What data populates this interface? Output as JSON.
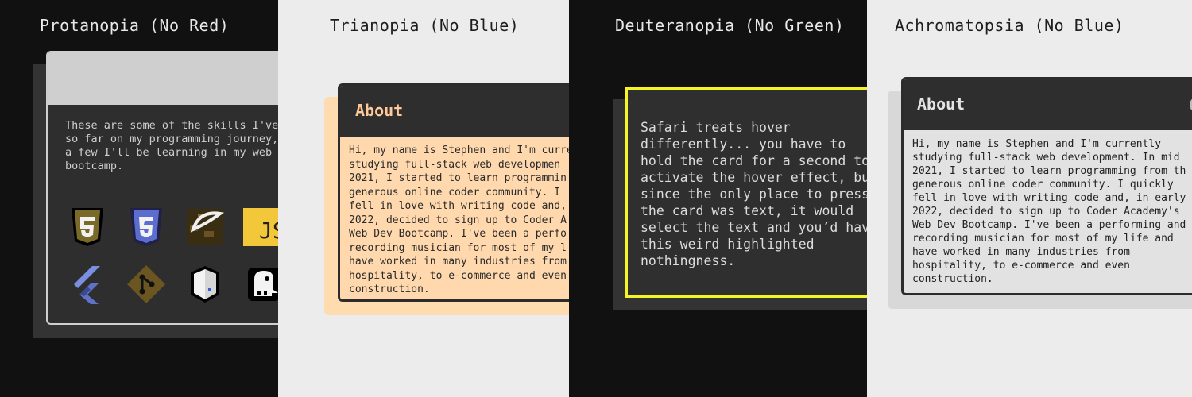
{
  "panels": [
    {
      "title": "Protanopia (No Red)",
      "card_text": "These are some of the skills I've\nso far on my programming journey,\na few I'll be learning in my web d\nbootcamp.",
      "icons": [
        "html5-icon",
        "css3-icon",
        "rails-icon",
        "javascript-icon",
        "flutter-icon",
        "git-icon",
        "npm-icon",
        "postgresql-icon"
      ],
      "icon_text": {
        "javascript": "JS"
      }
    },
    {
      "title": "Trianopia (No Blue)",
      "heading": "About",
      "card_text": "Hi, my name is Stephen and I'm curre\nstudying full-stack web developmen\n2021, I started to learn programmin\ngenerous online coder community. I\nfell in love with writing code and,\n2022, decided to sign up to Coder A\nWeb Dev Bootcamp. I've been a perfo\nrecording musician for most of my l\nhave worked in many industries from\nhospitality, to e-commerce and even\nconstruction."
    },
    {
      "title": "Deuteranopia (No Green)",
      "card_text": "Safari treats hover\ndifferently... you have to\nhold the card for a second to\nactivate the hover effect, bu\nsince the only place to press\nthe card was text, it would\nselect the text and you’d hav\nthis weird highlighted\nnothingness."
    },
    {
      "title": "Achromatopsia (No Blue)",
      "heading": "About",
      "card_text": "Hi, my name is Stephen and I'm currently\nstudying full-stack web development. In mid\n2021, I started to learn programming from th\ngenerous online coder community. I quickly\nfell in love with writing code and, in early\n2022, decided to sign up to Coder Academy's\nWeb Dev Bootcamp. I've been a performing and\nrecording musician for most of my life and\nhave worked in many industries from\nhospitality, to e-commerce and even\nconstruction."
    }
  ],
  "colors": {
    "dark_bg": "#111111",
    "light_bg": "#ececec",
    "card_dark": "#2e2e2e",
    "peach": "#ffd9ad",
    "highlight_yellow": "#f5f526"
  }
}
